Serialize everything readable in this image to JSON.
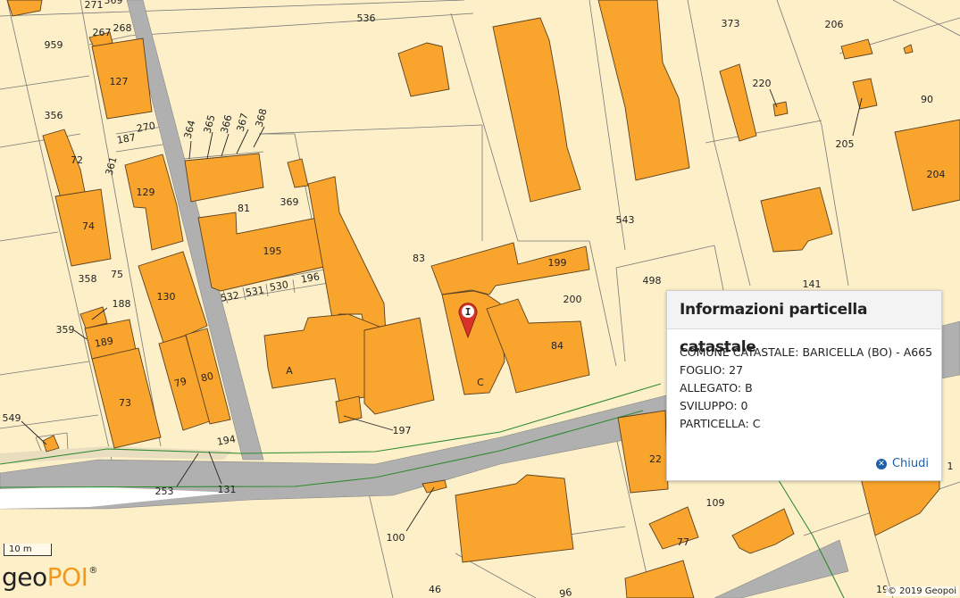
{
  "popup": {
    "title": "Informazioni particella catastale",
    "rows": [
      "COMUNE CATASTALE: BARICELLA (BO) - A665",
      "FOGLIO: 27",
      "ALLEGATO: B",
      "SVILUPPO: 0",
      "PARTICELLA: C"
    ],
    "close_label": "Chiudi"
  },
  "scale_label": "10 m",
  "logo": {
    "part1": "geo",
    "part2": "POI",
    "reg": "®"
  },
  "copyright": "© 2019 Geopoi",
  "colors": {
    "building": "#f9a52d",
    "background": "#fdf0c8",
    "road": "#b0b0b0",
    "link": "#1f5fa8"
  },
  "marker_letter": "I",
  "parcel_labels": [
    "271",
    "369",
    "536",
    "267",
    "268",
    "959",
    "127",
    "373",
    "206",
    "220",
    "90",
    "356",
    "187",
    "270",
    "364",
    "365",
    "366",
    "367",
    "368",
    "72",
    "361",
    "205",
    "204",
    "129",
    "81",
    "369",
    "543",
    "74",
    "195",
    "83",
    "199",
    "141",
    "75",
    "358",
    "532",
    "531",
    "530",
    "196",
    "498",
    "200",
    "188",
    "130",
    "359",
    "189",
    "A",
    "84",
    "79",
    "80",
    "C",
    "73",
    "197",
    "549",
    "194",
    "253",
    "131",
    "22",
    "1",
    "109",
    "100",
    "77",
    "46",
    "96",
    "19"
  ]
}
